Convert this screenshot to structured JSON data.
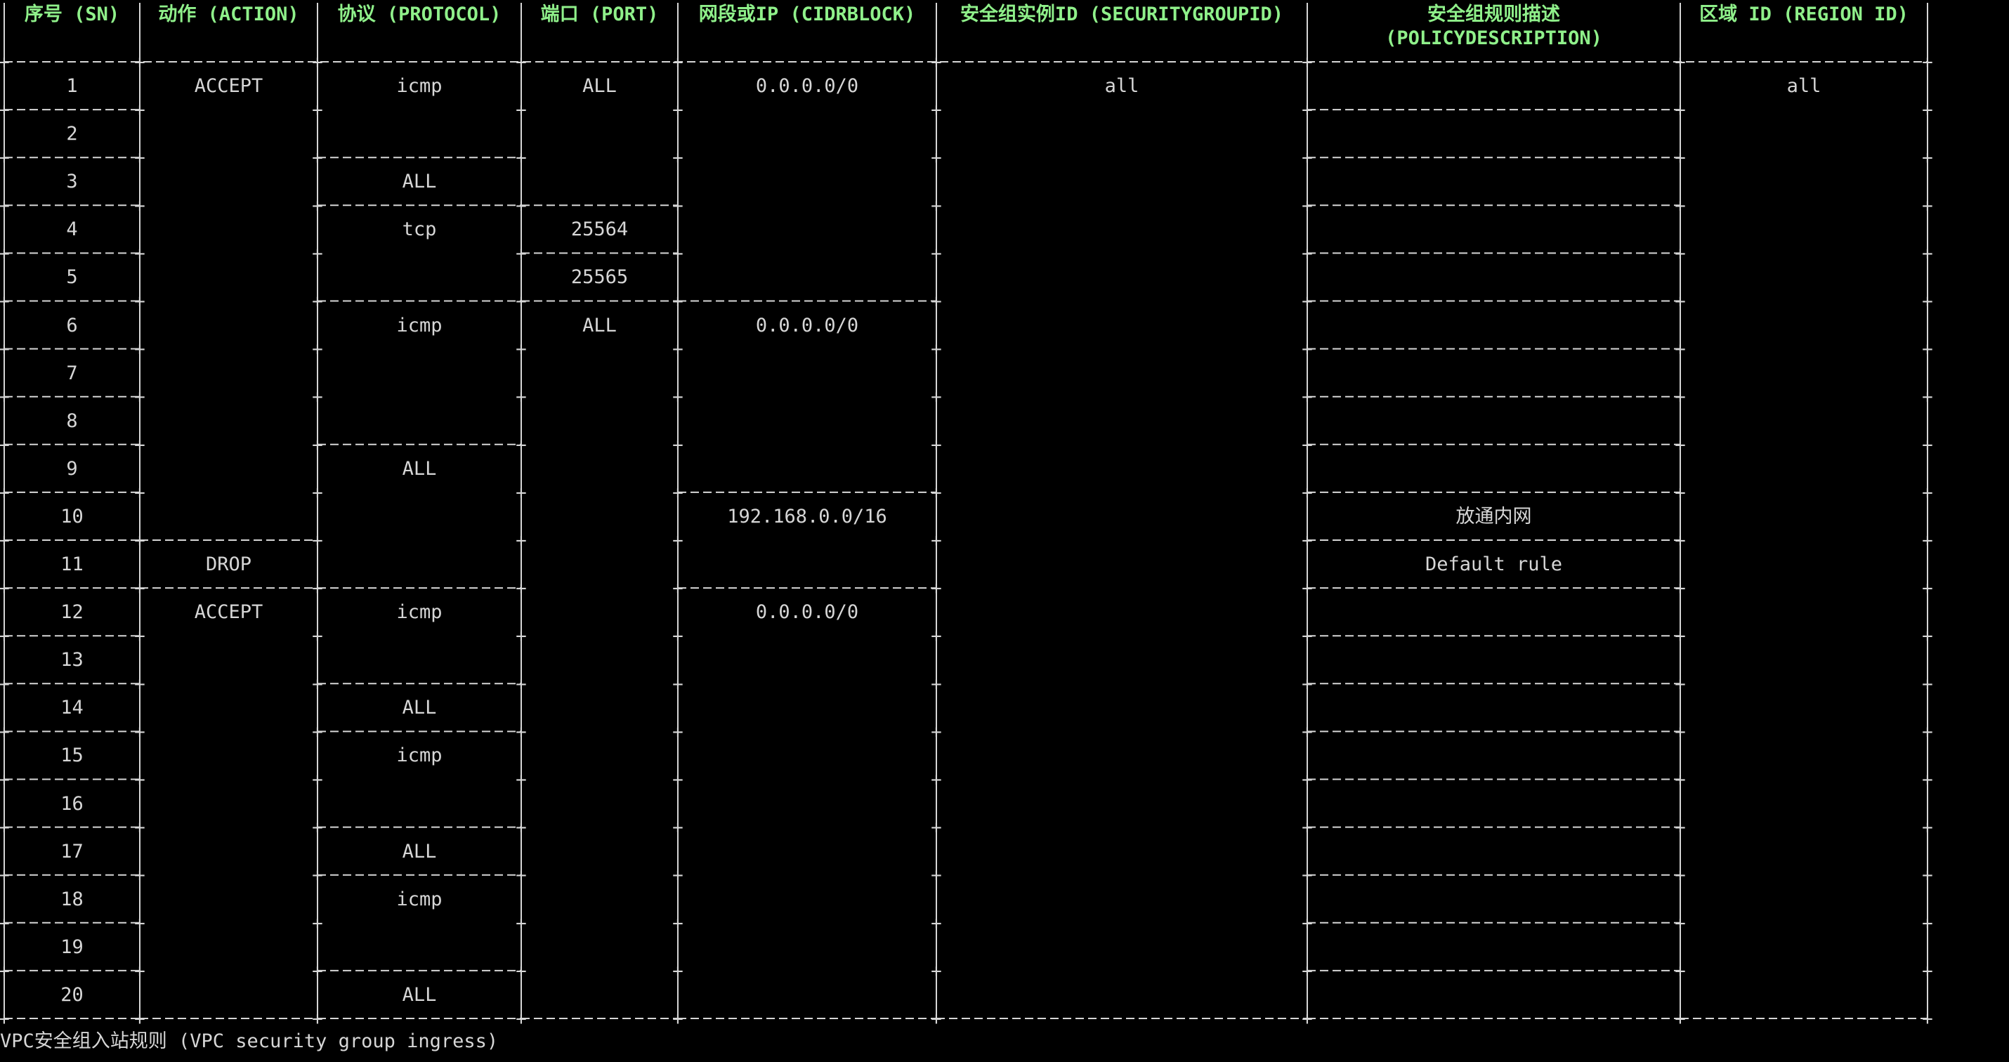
{
  "colors": {
    "background": "#000000",
    "text": "#d6d6d6",
    "header": "#8ff08a",
    "border": "#d6d6d6"
  },
  "table": {
    "headers": [
      "序号 (SN)",
      "动作 (ACTION)",
      "协议 (PROTOCOL)",
      "端口 (PORT)",
      "网段或IP (CIDRBLOCK)",
      "安全组实例ID (SECURITYGROUPID)",
      "安全组规则描述\n(POLICYDESCRIPTION)",
      "区域 ID (REGION ID)"
    ],
    "rows": [
      [
        "1",
        "ACCEPT",
        "icmp",
        "ALL",
        "0.0.0.0/0",
        "all",
        "",
        "all"
      ],
      [
        "2",
        "",
        "",
        "",
        "",
        "",
        "",
        ""
      ],
      [
        "3",
        "",
        "ALL",
        "",
        "",
        "",
        "",
        ""
      ],
      [
        "4",
        "",
        "tcp",
        "25564",
        "",
        "",
        "",
        ""
      ],
      [
        "5",
        "",
        "",
        "25565",
        "",
        "",
        "",
        ""
      ],
      [
        "6",
        "",
        "icmp",
        "ALL",
        "0.0.0.0/0",
        "",
        "",
        ""
      ],
      [
        "7",
        "",
        "",
        "",
        "",
        "",
        "",
        ""
      ],
      [
        "8",
        "",
        "",
        "",
        "",
        "",
        "",
        ""
      ],
      [
        "9",
        "",
        "ALL",
        "",
        "",
        "",
        "",
        ""
      ],
      [
        "10",
        "",
        "",
        "",
        "192.168.0.0/16",
        "",
        "放通内网",
        ""
      ],
      [
        "11",
        "DROP",
        "",
        "",
        "",
        "",
        "Default rule",
        ""
      ],
      [
        "12",
        "ACCEPT",
        "icmp",
        "",
        "0.0.0.0/0",
        "",
        "",
        ""
      ],
      [
        "13",
        "",
        "",
        "",
        "",
        "",
        "",
        ""
      ],
      [
        "14",
        "",
        "ALL",
        "",
        "",
        "",
        "",
        ""
      ],
      [
        "15",
        "",
        "icmp",
        "",
        "",
        "",
        "",
        ""
      ],
      [
        "16",
        "",
        "",
        "",
        "",
        "",
        "",
        ""
      ],
      [
        "17",
        "",
        "ALL",
        "",
        "",
        "",
        "",
        ""
      ],
      [
        "18",
        "",
        "icmp",
        "",
        "",
        "",
        "",
        ""
      ],
      [
        "19",
        "",
        "",
        "",
        "",
        "",
        "",
        ""
      ],
      [
        "20",
        "",
        "ALL",
        "",
        "",
        "",
        "",
        ""
      ]
    ]
  },
  "caption": "VPC安全组入站规则 (VPC security group ingress)"
}
